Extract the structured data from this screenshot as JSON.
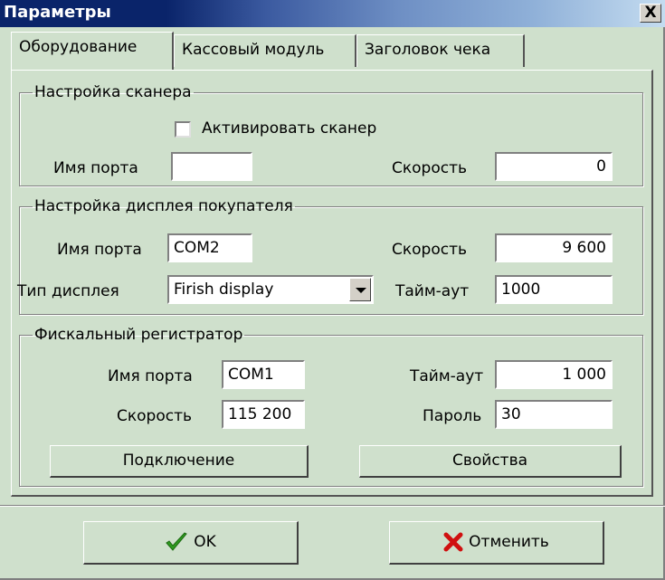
{
  "window": {
    "title": "Параметры",
    "close_label": "X"
  },
  "tabs": [
    {
      "label": "Оборудование",
      "active": true
    },
    {
      "label": "Кассовый модуль",
      "active": false
    },
    {
      "label": "Заголовок чека",
      "active": false
    }
  ],
  "scanner": {
    "legend": "Настройка сканера",
    "activate_label": "Активировать сканер",
    "activate_checked": false,
    "port_label": "Имя порта",
    "port_value": "",
    "speed_label": "Скорость",
    "speed_value": "0"
  },
  "display": {
    "legend": "Настройка дисплея покупателя",
    "port_label": "Имя порта",
    "port_value": "COM2",
    "speed_label": "Скорость",
    "speed_value": "9 600",
    "type_label": "Тип дисплея",
    "type_value": "Firish display",
    "timeout_label": "Тайм-аут",
    "timeout_value": "1000"
  },
  "fiscal": {
    "legend": "Фискальный регистратор",
    "port_label": "Имя порта",
    "port_value": "COM1",
    "timeout_label": "Тайм-аут",
    "timeout_value": "1 000",
    "speed_label": "Скорость",
    "speed_value": "115 200",
    "password_label": "Пароль",
    "password_value": "30",
    "connect_label": "Подключение",
    "properties_label": "Свойства"
  },
  "footer": {
    "ok_label": "OK",
    "cancel_label": "Отменить"
  },
  "colors": {
    "background": "#cfe0cc",
    "title_bar": "#0a246a",
    "ok_check": "#2e9a1e",
    "cancel_x": "#d01010"
  }
}
